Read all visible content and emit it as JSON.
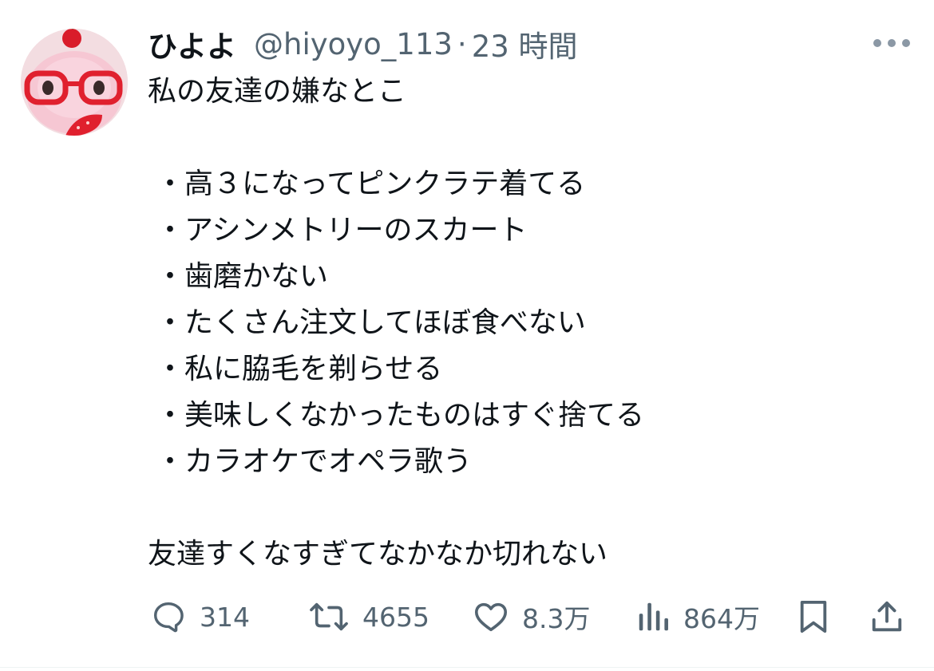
{
  "post": {
    "display_name": "ひよよ",
    "handle": "@hiyoyo_113",
    "separator": "·",
    "time": "23 時間",
    "text_intro": "私の友達の嫌なとこ",
    "list": [
      "・高３になってピンクラテ着てる",
      "・アシンメトリーのスカート",
      "・歯磨かない",
      "・たくさん注文してほぼ食べない",
      "・私に脇毛を剃らせる",
      "・美味しくなかったものはすぐ捨てる",
      "・カラオケでオペラ歌う"
    ],
    "text_outro": "友達すくなすぎてなかなか切れない"
  },
  "actions": {
    "replies": "314",
    "reposts": "4655",
    "likes": "8.3万",
    "views": "864万"
  },
  "icons": {
    "avatar": "avatar-pink-plush-with-red-glasses",
    "more": "more-dots-icon",
    "reply": "reply-bubble-icon",
    "repost": "repost-arrows-icon",
    "like": "heart-icon",
    "views": "views-bars-icon",
    "bookmark": "bookmark-icon",
    "share": "share-upload-icon"
  },
  "colors": {
    "text": "#0f1419",
    "secondary": "#536471",
    "icon": "#536471"
  }
}
